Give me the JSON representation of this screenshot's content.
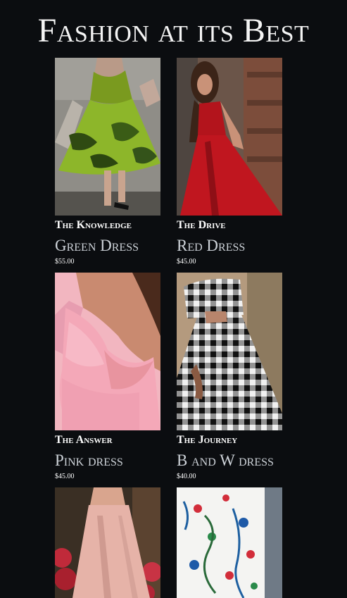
{
  "page": {
    "title": "Fashion at its Best"
  },
  "products": [
    {
      "collection": "The Knowledge",
      "name": "Green Dress",
      "price": "$55.00"
    },
    {
      "collection": "The Drive",
      "name": "Red Dress",
      "price": "$45.00"
    },
    {
      "collection": "The Answer",
      "name": "Pink dress",
      "price": "$45.00"
    },
    {
      "collection": "The Journey",
      "name": "B and W dress",
      "price": "$40.00"
    }
  ]
}
